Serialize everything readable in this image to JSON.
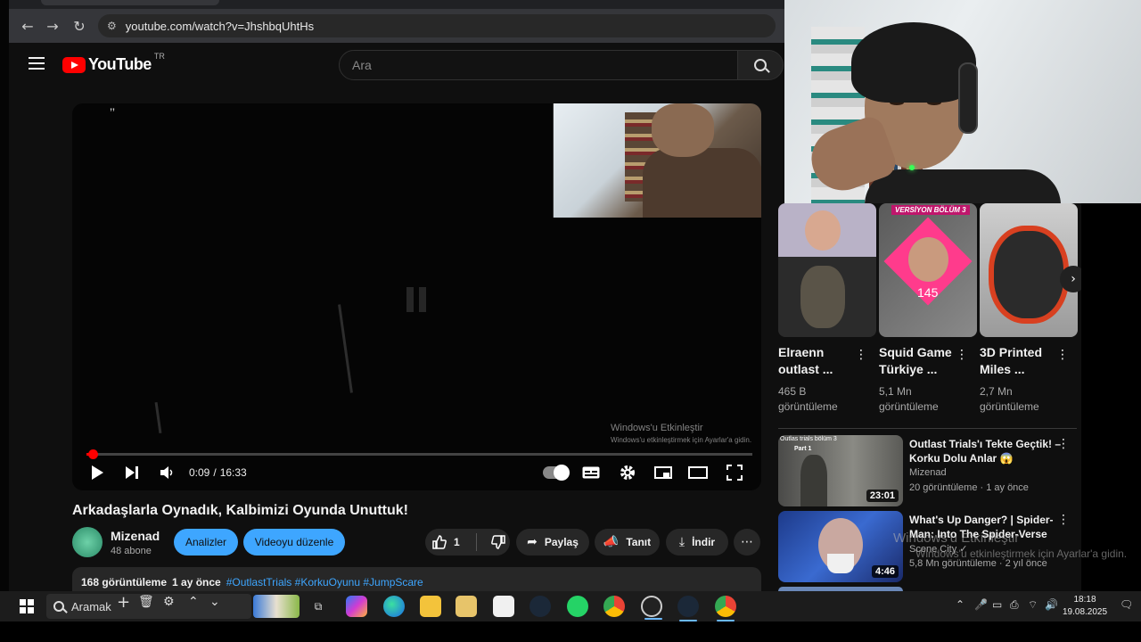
{
  "browser": {
    "url": "youtube.com/watch?v=JhshbqUhtHs"
  },
  "youtube": {
    "logo_text": "YouTube",
    "region": "TR",
    "search_placeholder": "Ara"
  },
  "player": {
    "overlay_quote": "’’",
    "time_current": "0:09",
    "time_separator": "/",
    "time_total": "16:33",
    "progress_fraction": 0.009,
    "watermark_line1": "Windows'u Etkinleştir",
    "watermark_line2": "Windows'u etkinleştirmek için Ayarlar'a gidin."
  },
  "video": {
    "title": "Arkadaşlarla Oynadık, Kalbimizi Oyunda Unuttuk!",
    "channel_name": "Mizenad",
    "channel_subs": "48 abone",
    "analytics_label": "Analizler",
    "edit_label": "Videoyu düzenle",
    "like_count": "1",
    "share_label": "Paylaş",
    "promote_label": "Tanıt",
    "download_label": "İndir",
    "views": "168 görüntüleme",
    "age": "1 ay önce",
    "tags": "#OutlastTrials #KorkuOyunu #JumpScare"
  },
  "shorts": [
    {
      "title": "Elraenn outlast ...",
      "views_line1": "465 B",
      "views_line2": "görüntüleme"
    },
    {
      "title": "Squid Game Türkiye ...",
      "views_line1": "5,1 Mn",
      "views_line2": "görüntüleme",
      "thumb_banner": "VERSİYON BÖLÜM 3",
      "thumb_number": "145"
    },
    {
      "title": "3D Printed Miles ...",
      "views_line1": "2,7 Mn",
      "views_line2": "görüntüleme"
    }
  ],
  "recommendations": [
    {
      "title": "Outlast Trials'ı Tekte Geçtik! – Korku Dolu Anlar 😱",
      "channel": "Mizenad",
      "meta": "20 görüntüleme · 1 ay önce",
      "duration": "23:01",
      "thumb_caption": "Outlas trials bölüm 3",
      "thumb_part": "Part 1"
    },
    {
      "title": "What's Up Danger? | Spider-Man: Into The Spider-Verse",
      "channel": "Scene City ✓",
      "meta": "5,8 Mn görüntüleme · 2 yıl önce",
      "duration": "4:46"
    }
  ],
  "right_watermark": {
    "line1": "Windows'u Etkinleştir",
    "line2": "Windows'u etkinleştirmek için Ayarlar'a gidin."
  },
  "taskbar": {
    "search_text": "Aramak",
    "time": "18:18",
    "date": "19.08.2025"
  },
  "colors": {
    "yt_bg": "#0f0f0f",
    "accent_red": "#ff0000",
    "accent_blue": "#3ea6ff",
    "taskbar": "#1c1c1c"
  }
}
